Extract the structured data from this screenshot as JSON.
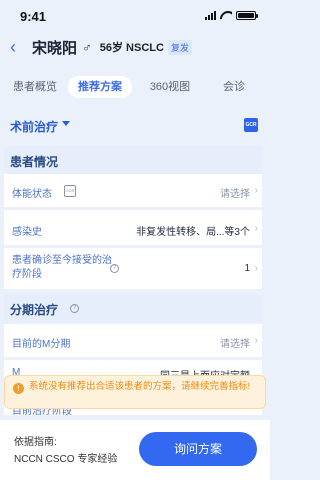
{
  "status_bar": {
    "time": "9:41"
  },
  "header": {
    "patient_name": "宋晓阳",
    "gender_symbol": "♂",
    "meta": "56岁 NSCLC",
    "badge": "复发"
  },
  "tabs": [
    {
      "label": "患者概览",
      "active": false
    },
    {
      "label": "推荐方案",
      "active": true
    },
    {
      "label": "360视图",
      "active": false
    },
    {
      "label": "会诊",
      "active": false
    }
  ],
  "section": {
    "title": "术前治疗",
    "icon": "gcr-icon"
  },
  "groups": [
    {
      "title": "患者情况",
      "rows": [
        {
          "label": "体能状态",
          "value": "请选择",
          "placeholder": true
        },
        {
          "label": "感染史",
          "value": "非复发性转移、局...等3个",
          "placeholder": false
        },
        {
          "label": "患者确诊至今接受的治疗阶段",
          "value": "1",
          "placeholder": false
        }
      ]
    },
    {
      "title": "分期治疗",
      "rows": [
        {
          "label": "目前的M分期",
          "value": "请选择",
          "placeholder": true
        },
        {
          "label": "M",
          "value": "同三是上面应对定额",
          "placeholder": false
        },
        {
          "label": "目前治疗阶段",
          "value": "",
          "placeholder": true
        }
      ]
    }
  ],
  "toast": {
    "message": "系统没有推荐出合适该患者的方案，请继续完善指标!"
  },
  "bottom": {
    "basis_label": "依据指南:",
    "basis_value": "NCCN CSCO 专家经验",
    "consult_button": "询问方案"
  },
  "colors": {
    "accent": "#3368f0",
    "warning": "#f08a12",
    "background": "#eaf1fb"
  }
}
